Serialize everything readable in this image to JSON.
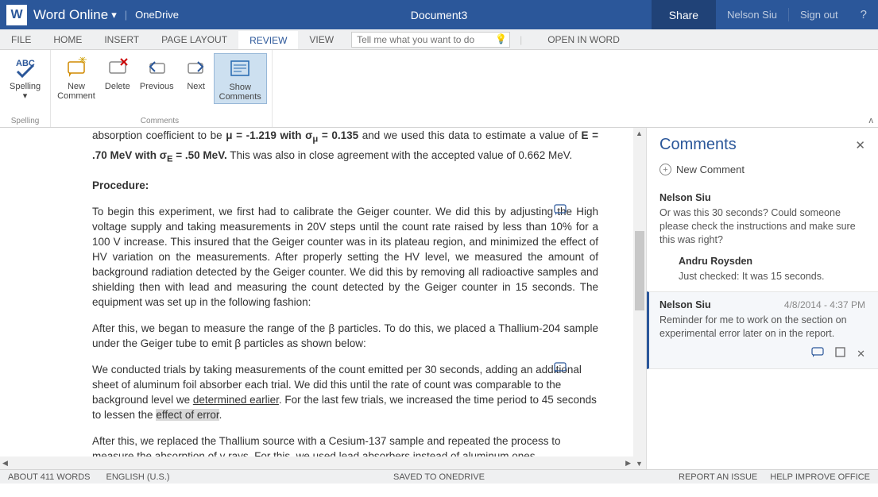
{
  "titlebar": {
    "app": "Word Online",
    "location": "OneDrive",
    "doc": "Document3",
    "share": "Share",
    "user": "Nelson Siu",
    "signout": "Sign out"
  },
  "tabs": {
    "file": "FILE",
    "home": "HOME",
    "insert": "INSERT",
    "pagelayout": "PAGE LAYOUT",
    "review": "REVIEW",
    "view": "VIEW",
    "tellme": "Tell me what you want to do",
    "openword": "OPEN IN WORD"
  },
  "ribbon": {
    "spelling": "Spelling",
    "spelling_grp": "Spelling",
    "newcomment": "New\nComment",
    "delete": "Delete",
    "previous": "Previous",
    "next": "Next",
    "show": "Show\nComments",
    "comments_grp": "Comments"
  },
  "doc": {
    "line1_a": "absorption coefficient to be ",
    "line1_b": "μ = -1.219 with σ",
    "line1_c": " = 0.135",
    "line1_d": " and we used this data to estimate a value of ",
    "line1_e": "E = .70 MeV with σ",
    "line1_f": " = .50 MeV.",
    "line1_g": " This was also in close agreement with the accepted value of 0.662 MeV.",
    "procedure": "Procedure:",
    "p1": "To begin this experiment, we first had to calibrate the Geiger counter. We did this by adjusting the High voltage supply and taking measurements in 20V steps until the count rate raised by less than 10% for a 100 V increase. This insured that the Geiger counter was in its plateau region, and minimized the effect of HV variation on the measurements. After properly setting the HV level, we measured the amount of background radiation detected by the Geiger counter. We did this by removing all radioactive samples and shielding then with lead and measuring the count detected by the Geiger counter in 15 seconds. The equipment was set up in the following fashion:",
    "p2": "After this, we began to measure the range of the β particles. To do this, we placed a Thallium-204 sample under the Geiger tube to emit β particles as shown below:",
    "p3a": "We conducted trials by taking measurements of the count emitted per 30 seconds, adding an additional sheet of aluminum foil absorber each trial. We did this until the rate of count was comparable to the background level we ",
    "p3u": "determined earlier",
    "p3b": ". For the last few trials, we increased the time period to 45 seconds to lessen the ",
    "p3h": "effect of error",
    "p3c": ".",
    "p4": "After this, we replaced the Thallium source with a Cesium-137 sample and repeated the process to measure the absorption of γ rays. For this, we used lead absorbers instead of aluminum ones.",
    "sub_mu": "μ",
    "sub_e": "E"
  },
  "comments": {
    "title": "Comments",
    "new": "New Comment",
    "t1_author": "Nelson Siu",
    "t1_body": "Or was this 30 seconds?  Could someone please check the instructions and make sure this was right?",
    "t1r_author": "Andru Roysden",
    "t1r_body": "Just checked: It was 15 seconds.",
    "t2_author": "Nelson Siu",
    "t2_date": "4/8/2014 - 4:37 PM",
    "t2_body": "Reminder for me to work on the section on experimental error later on in the report."
  },
  "status": {
    "words": "ABOUT 411 WORDS",
    "lang": "ENGLISH (U.S.)",
    "saved": "SAVED TO ONEDRIVE",
    "report": "REPORT AN ISSUE",
    "improve": "HELP IMPROVE OFFICE"
  }
}
